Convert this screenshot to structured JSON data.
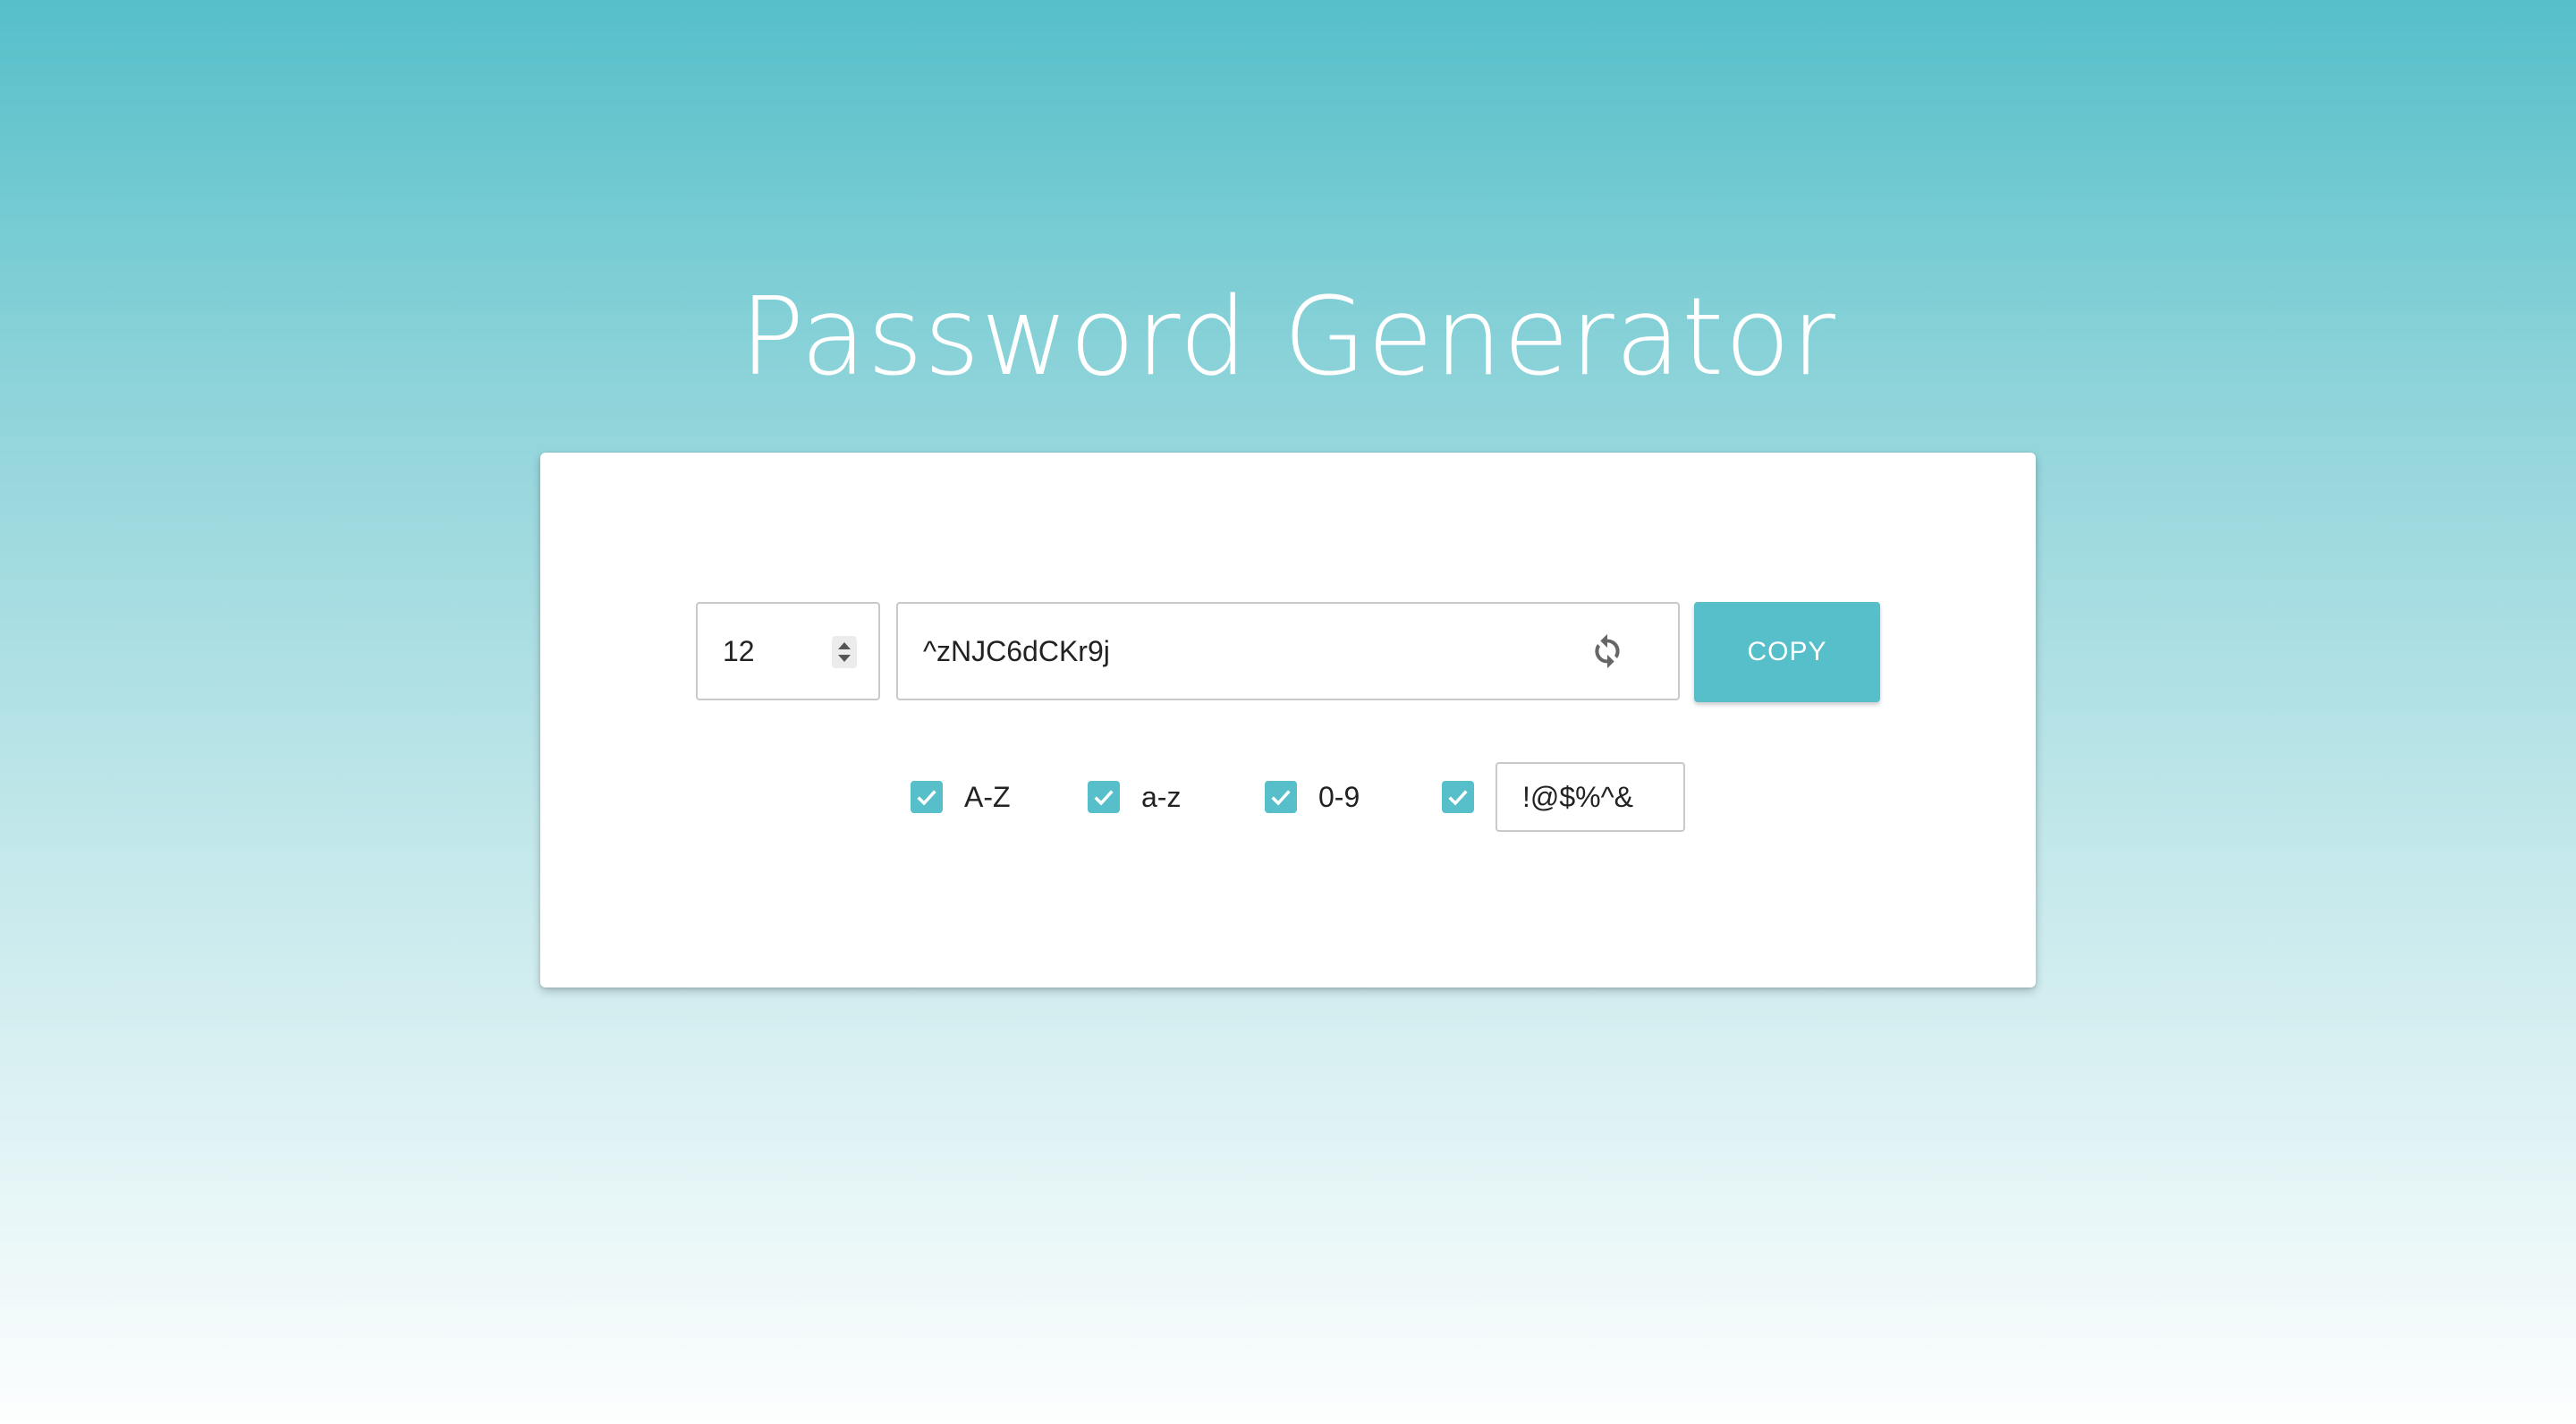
{
  "page": {
    "title": "Password Generator"
  },
  "generator": {
    "length_value": "12",
    "password_value": "^zNJC6dCKr9j",
    "copy_label": "COPY",
    "refresh_icon": "refresh-icon"
  },
  "options": [
    {
      "label": "A-Z",
      "checked": true
    },
    {
      "label": "a-z",
      "checked": true
    },
    {
      "label": "0-9",
      "checked": true
    },
    {
      "label": "",
      "checked": true
    }
  ],
  "symbols": {
    "value": "!@$%^&"
  },
  "colors": {
    "accent": "#56bfc9",
    "background_top": "#56bfc9",
    "background_bottom": "#fdfefe",
    "card": "#ffffff"
  }
}
